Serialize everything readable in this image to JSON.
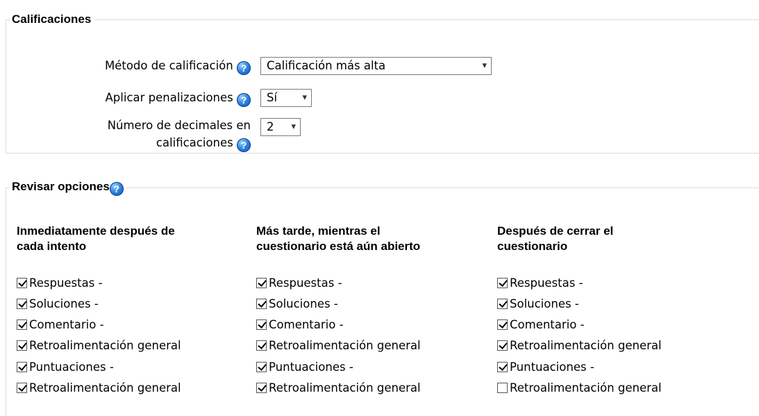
{
  "grades": {
    "legend": "Calificaciones",
    "method_label": "Método de calificación",
    "method_value": "Calificación más alta",
    "penalties_label": "Aplicar penalizaciones",
    "penalties_value": "Sí",
    "decimals_label_line1": "Número de decimales en",
    "decimals_label_line2": "calificaciones",
    "decimals_value": "2"
  },
  "review": {
    "legend": "Revisar opciones",
    "columns": [
      {
        "header_line1": "Inmediatamente después de",
        "header_line2": "cada intento",
        "options": [
          {
            "label": "Respuestas -",
            "checked": true
          },
          {
            "label": "Soluciones -",
            "checked": true
          },
          {
            "label": "Comentario -",
            "checked": true
          },
          {
            "label": "Retroalimentación general",
            "checked": true
          },
          {
            "label": "Puntuaciones -",
            "checked": true
          },
          {
            "label": "Retroalimentación general",
            "checked": true
          }
        ]
      },
      {
        "header_line1": "Más tarde, mientras el",
        "header_line2": "cuestionario está aún abierto",
        "options": [
          {
            "label": "Respuestas -",
            "checked": true
          },
          {
            "label": "Soluciones -",
            "checked": true
          },
          {
            "label": "Comentario -",
            "checked": true
          },
          {
            "label": "Retroalimentación general",
            "checked": true
          },
          {
            "label": "Puntuaciones -",
            "checked": true
          },
          {
            "label": "Retroalimentación general",
            "checked": true
          }
        ]
      },
      {
        "header_line1": "Después de cerrar el",
        "header_line2": "cuestionario",
        "options": [
          {
            "label": "Respuestas -",
            "checked": true
          },
          {
            "label": "Soluciones -",
            "checked": true
          },
          {
            "label": "Comentario -",
            "checked": true
          },
          {
            "label": "Retroalimentación general",
            "checked": true
          },
          {
            "label": "Puntuaciones -",
            "checked": true
          },
          {
            "label": "Retroalimentación general",
            "checked": false
          }
        ]
      }
    ]
  },
  "icons": {
    "help": "help-icon",
    "caret": "chevron-down-icon",
    "checkbox": "checkbox-icon"
  }
}
